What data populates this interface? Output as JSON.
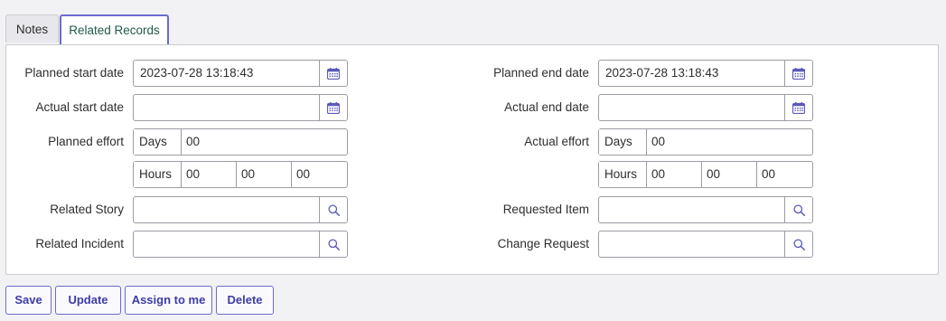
{
  "tabs": {
    "notes": "Notes",
    "related_records": "Related Records"
  },
  "left": {
    "planned_start_label": "Planned start date",
    "planned_start_value": "2023-07-28 13:18:43",
    "actual_start_label": "Actual start date",
    "actual_start_value": "",
    "planned_effort_label": "Planned effort",
    "planned_effort_days_unit": "Days",
    "planned_effort_days": "00",
    "planned_effort_hours_unit": "Hours",
    "planned_effort_hh": "00",
    "planned_effort_mm": "00",
    "planned_effort_ss": "00",
    "related_story_label": "Related Story",
    "related_story_value": "",
    "related_incident_label": "Related Incident",
    "related_incident_value": ""
  },
  "right": {
    "planned_end_label": "Planned end date",
    "planned_end_value": "2023-07-28 13:18:43",
    "actual_end_label": "Actual end date",
    "actual_end_value": "",
    "actual_effort_label": "Actual effort",
    "actual_effort_days_unit": "Days",
    "actual_effort_days": "00",
    "actual_effort_hours_unit": "Hours",
    "actual_effort_hh": "00",
    "actual_effort_mm": "00",
    "actual_effort_ss": "00",
    "requested_item_label": "Requested Item",
    "requested_item_value": "",
    "change_request_label": "Change Request",
    "change_request_value": ""
  },
  "actions": {
    "save": "Save",
    "update": "Update",
    "assign_to_me": "Assign to me",
    "delete": "Delete"
  },
  "icons": {
    "date": "calendar-icon",
    "lookup": "search-icon"
  },
  "colors": {
    "accent": "#6b6bd0",
    "button_text": "#3d3da8",
    "tab_active_text": "#1f5a4a"
  }
}
